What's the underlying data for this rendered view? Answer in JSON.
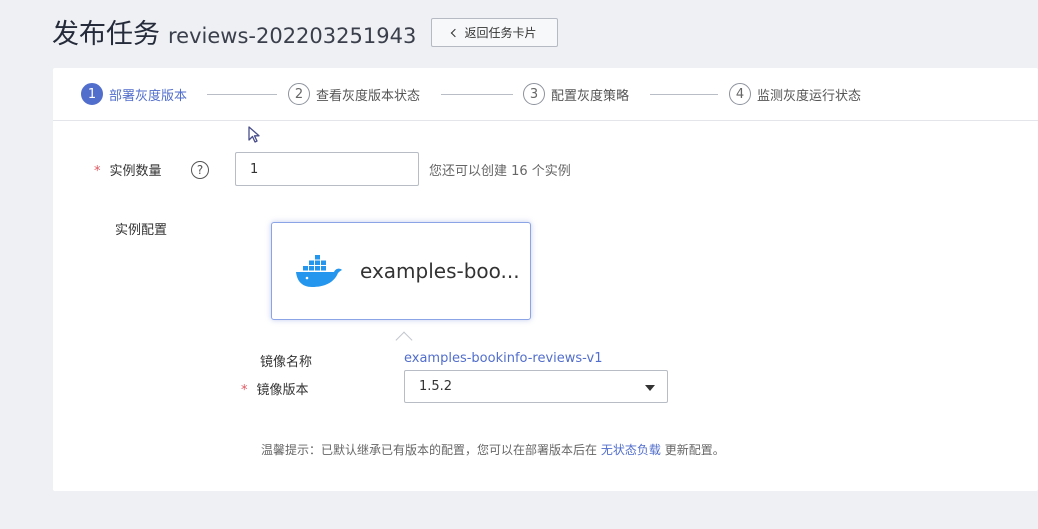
{
  "header": {
    "title": "发布任务",
    "task_name": "reviews-202203251943",
    "back_label": "返回任务卡片"
  },
  "steps": [
    {
      "num": "1",
      "label": "部署灰度版本",
      "active": true
    },
    {
      "num": "2",
      "label": "查看灰度版本状态",
      "active": false
    },
    {
      "num": "3",
      "label": "配置灰度策略",
      "active": false
    },
    {
      "num": "4",
      "label": "监测灰度运行状态",
      "active": false
    }
  ],
  "form": {
    "instance_count": {
      "required_mark": "*",
      "label": "实例数量",
      "help_icon": "?",
      "value": "1",
      "hint": "您还可以创建 16 个实例"
    },
    "instance_config": {
      "label": "实例配置",
      "image_card": {
        "icon": "docker-whale-icon",
        "name": "examples-boo..."
      }
    },
    "image_name": {
      "label": "镜像名称",
      "value": "examples-bookinfo-reviews-v1"
    },
    "image_version": {
      "required_mark": "*",
      "label": "镜像版本",
      "value": "1.5.2"
    },
    "tip": {
      "prefix": "温馨提示：已默认继承已有版本的配置，您可以在部署版本后在",
      "link": "无状态负载",
      "suffix": "更新配置。"
    }
  },
  "colors": {
    "accent": "#526ecc",
    "required": "#e15760",
    "background": "#eef0f4",
    "docker_blue": "#2496ed"
  }
}
